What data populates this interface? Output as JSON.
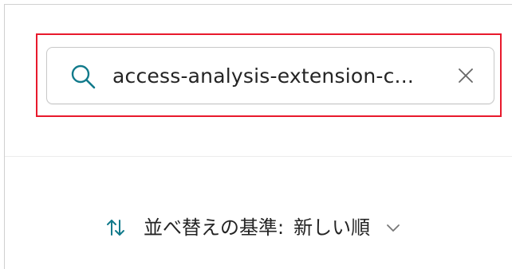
{
  "search": {
    "value": "access-analysis-extension-c...",
    "search_icon": "search-icon",
    "clear_icon": "close-icon"
  },
  "sort": {
    "icon": "sort-arrows-icon",
    "label": "並べ替えの基準:",
    "value": "新しい順",
    "chevron_icon": "chevron-down-icon"
  },
  "colors": {
    "highlight_border": "#e8192c",
    "icon_teal": "#117a8b",
    "text": "#242424",
    "muted_icon": "#777777"
  }
}
